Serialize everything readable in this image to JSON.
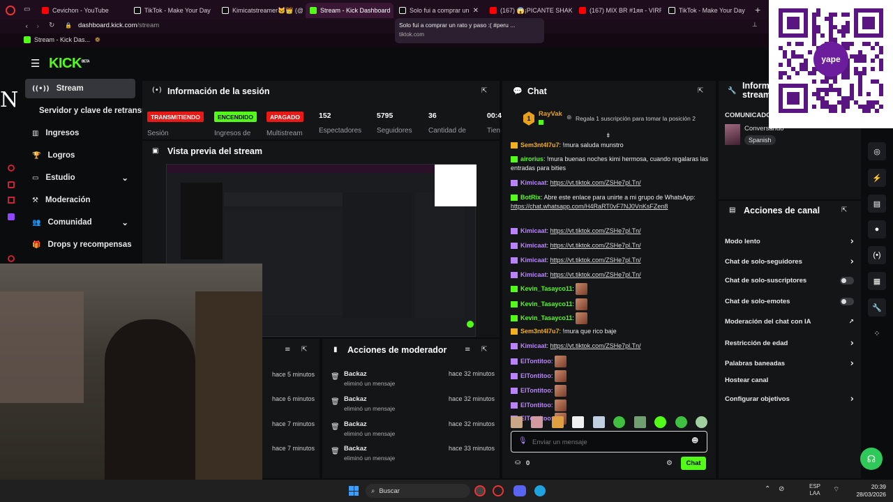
{
  "browser": {
    "tabs": [
      {
        "label": "Cevichon - YouTube",
        "color": "#ff0000"
      },
      {
        "label": "TikTok - Make Your Day",
        "color": "#ffffff"
      },
      {
        "label": "Kimicatstreamer🐱👑 (@",
        "color": "#ffffff"
      },
      {
        "label": "Stream - Kick Dashboard",
        "color": "#53fc18"
      },
      {
        "label": "Solo fui a comprar un",
        "color": "#ffffff"
      },
      {
        "label": "(167) 😱¡PICANTE SHAKA",
        "color": "#ff0000"
      },
      {
        "label": "(167) MIX BR #1ᴙᴙ - VIRRS",
        "color": "#ff0000"
      },
      {
        "label": "TikTok - Make Your Day",
        "color": "#ffffff"
      }
    ],
    "close_glyph": "✕",
    "new_tab_glyph": "+",
    "url_host": "dashboard.kick.com",
    "url_path": "/stream",
    "bookmark": "Stream - Kick Das...",
    "tooltip_title": "Solo fui a comprar un rato y paso :( #peru ...",
    "tooltip_url": "tiktok.com"
  },
  "header": {
    "logo": "KICK",
    "logo_sup": "BETA"
  },
  "sidebar": {
    "items": [
      {
        "label": "Stream",
        "icon": "broadcast-icon"
      },
      {
        "label": "Servidor y clave de retransm",
        "icon": ""
      },
      {
        "label": "Ingresos",
        "icon": "chart-icon"
      },
      {
        "label": "Logros",
        "icon": "trophy-icon"
      },
      {
        "label": "Estudio",
        "icon": "monitor-icon"
      },
      {
        "label": "Moderación",
        "icon": "hammer-icon"
      },
      {
        "label": "Comunidad",
        "icon": "people-icon"
      },
      {
        "label": "Drops y recompensas",
        "icon": "gift-icon"
      }
    ],
    "chevron": "⌄",
    "left_letter": "N"
  },
  "session": {
    "title": "Información de la sesión",
    "badges": [
      {
        "text": "TRANSMITIENDO",
        "label": "Sesión"
      },
      {
        "text": "ENCENDIDO",
        "label": "Ingresos de"
      },
      {
        "text": "APAGADO",
        "label": "Multistream"
      }
    ],
    "stats": [
      {
        "value": "152",
        "label": "Espectadores"
      },
      {
        "value": "5795",
        "label": "Seguidores"
      },
      {
        "value": "36",
        "label": "Cantidad de"
      },
      {
        "value": "00:4",
        "label": "Tien"
      }
    ],
    "colors": {
      "live": "#e91916",
      "on": "#53fc18",
      "off": "#e91916"
    }
  },
  "preview": {
    "title": "Vista previa del stream"
  },
  "moderator": {
    "title": "Acciones de moderador",
    "left_times": [
      "hace 5 minutos",
      "hace 6 minutos",
      "hace 7 minutos",
      "hace 7 minutos"
    ],
    "rows": [
      {
        "user": "Backaz",
        "action": "eliminó un mensaje",
        "time": "hace 32 minutos"
      },
      {
        "user": "Backaz",
        "action": "eliminó un mensaje",
        "time": "hace 32 minutos"
      },
      {
        "user": "Backaz",
        "action": "eliminó un mensaje",
        "time": "hace 32 minutos"
      },
      {
        "user": "Backaz",
        "action": "eliminó un mensaje",
        "time": "hace 33 minutos"
      }
    ]
  },
  "chat": {
    "title": "Chat",
    "gift_user": "RayVak",
    "gift_rank": "1",
    "gift_text": "Regala 1 suscripción para tomar la posición 2",
    "messages": [
      {
        "user": "Sem3nt4l7u7",
        "color": "#f2b01e",
        "text": "!mura saluda munstro",
        "link": ""
      },
      {
        "user": "airorius",
        "color": "#53fc18",
        "text": "!mura buenas noches kimi hermosa, cuando regalaras las entradas para bities",
        "link": ""
      },
      {
        "user": "Kimicaat",
        "color": "#b983ff",
        "text": "",
        "link": "https://vt.tiktok.com/ZSHe7pl.Tn/"
      },
      {
        "user": "BotRix",
        "color": "#53fc18",
        "text": "Abre este enlace para unirte a mi grupo de WhatsApp:",
        "link": "https://chat.whatsapp.com/H4RaRT0vF7NJ0VnKsFZen8"
      },
      {
        "user": "Kimicaat",
        "color": "#b983ff",
        "text": "",
        "link": "https://vt.tiktok.com/ZSHe7pl.Tn/"
      },
      {
        "user": "Kimicaat",
        "color": "#b983ff",
        "text": "",
        "link": "https://vt.tiktok.com/ZSHe7pl.Tn/"
      },
      {
        "user": "Kimicaat",
        "color": "#b983ff",
        "text": "",
        "link": "https://vt.tiktok.com/ZSHe7pl.Tn/"
      },
      {
        "user": "Kimicaat",
        "color": "#b983ff",
        "text": "",
        "link": "https://vt.tiktok.com/ZSHe7pl.Tn/"
      },
      {
        "user": "Kevin_Tasayco11",
        "color": "#53fc18",
        "text": "",
        "link": ""
      },
      {
        "user": "Kevin_Tasayco11",
        "color": "#53fc18",
        "text": "",
        "link": ""
      },
      {
        "user": "Kevin_Tasayco11",
        "color": "#53fc18",
        "text": "",
        "link": ""
      },
      {
        "user": "Sem3nt4l7u7",
        "color": "#f2b01e",
        "text": "!mura que rico baje",
        "link": ""
      },
      {
        "user": "Kimicaat",
        "color": "#b983ff",
        "text": "",
        "link": "https://vt.tiktok.com/ZSHe7pl.Tn/"
      },
      {
        "user": "ElTontitoo",
        "color": "#b983ff",
        "text": "",
        "link": ""
      },
      {
        "user": "ElTontitoo",
        "color": "#b983ff",
        "text": "",
        "link": ""
      },
      {
        "user": "ElTontitoo",
        "color": "#b983ff",
        "text": "",
        "link": ""
      },
      {
        "user": "ElTontitoo",
        "color": "#b983ff",
        "text": "",
        "link": ""
      },
      {
        "user": "ElTontitoo",
        "color": "#b983ff",
        "text": "",
        "link": ""
      }
    ],
    "input_placeholder": "Enviar un mensaje",
    "points": "0",
    "send_label": "Chat"
  },
  "info_panel": {
    "title": "Inform stream",
    "announcement_label": "COMUNICADO",
    "category": "Conversando",
    "language": "Spanish"
  },
  "channel_actions": {
    "title": "Acciones de canal",
    "items": [
      {
        "label": "Modo lento",
        "control": "chevron"
      },
      {
        "label": "Chat de solo-seguidores",
        "control": "chevron"
      },
      {
        "label": "Chat de solo-suscriptores",
        "control": "toggle"
      },
      {
        "label": "Chat de solo-emotes",
        "control": "toggle"
      },
      {
        "label": "Moderación del chat con IA",
        "control": "external"
      },
      {
        "label": "Restricción de edad",
        "control": "chevron"
      },
      {
        "label": "Palabras baneadas",
        "control": "chevron"
      },
      {
        "label": "Hostear canal",
        "control": "none"
      },
      {
        "label": "Configurar objetivos",
        "control": "chevron"
      }
    ]
  },
  "qr": {
    "brand": "yape"
  },
  "taskbar": {
    "search": "Buscar",
    "lang": "ESP",
    "lang2": "LAA",
    "time": "20:39",
    "date": "28/03/2026"
  }
}
